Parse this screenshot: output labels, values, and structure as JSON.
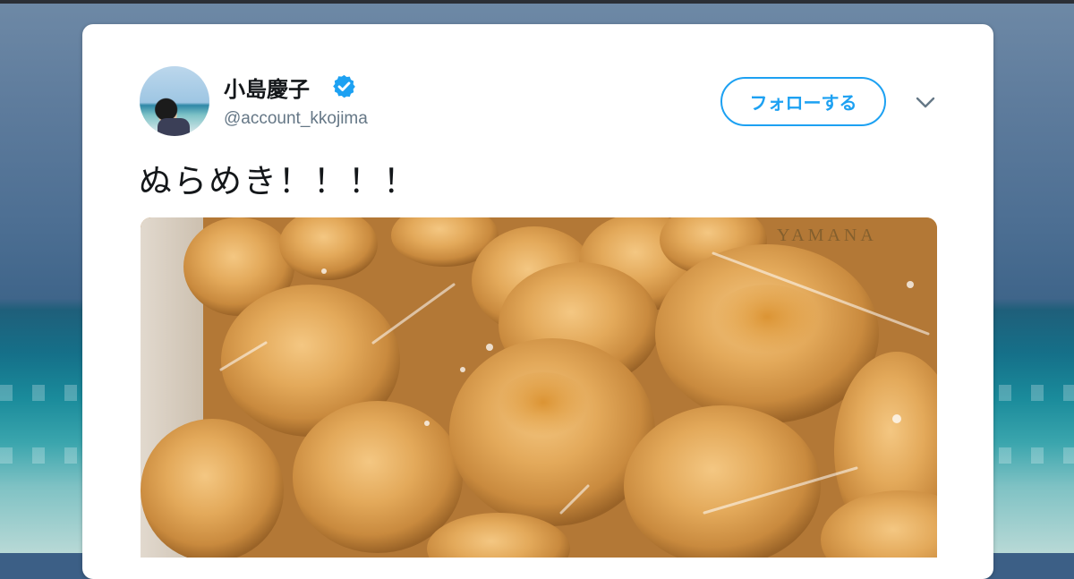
{
  "tweet": {
    "author_name": "小島慶子",
    "author_handle": "@account_kkojima",
    "verified": true,
    "follow_label": "フォローする",
    "text": "ぬらめき！！！！",
    "photo_watermark": "YAMANA"
  },
  "icons": {
    "verified": "verified-badge-icon",
    "menu": "chevron-down-icon"
  },
  "colors": {
    "accent": "#1da1f2",
    "verified": "#1da1f2",
    "name": "#14171a",
    "handle": "#657786",
    "card": "#ffffff"
  }
}
